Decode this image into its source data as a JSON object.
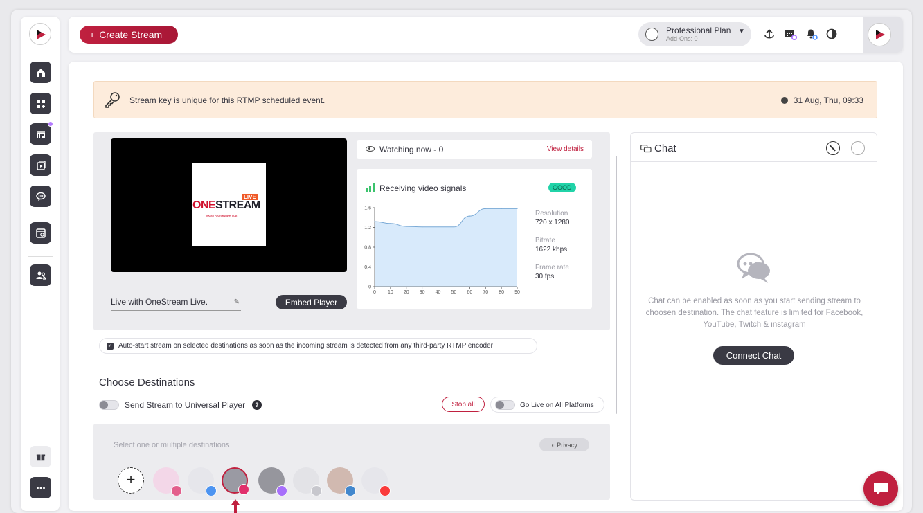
{
  "header": {
    "create_stream_label": "Create Stream",
    "plan_name": "Professional Plan",
    "addons": "Add-Ons: 0"
  },
  "banner": {
    "text": "Stream key is unique for this RTMP scheduled event.",
    "datetime": "31 Aug, Thu, 09:33"
  },
  "preview": {
    "card_live": "LIVE",
    "card_brand_one": "ONE",
    "card_brand_stream": "STREAM",
    "card_url": "www.onestream.live",
    "stream_title": "Live with OneStream Live.",
    "embed_label": "Embed Player"
  },
  "watching": {
    "text": "Watching now - 0",
    "view_details": "View details"
  },
  "signal": {
    "title": "Receiving video signals",
    "badge": "GOOD",
    "resolution_label": "Resolution",
    "resolution_value": "720 x 1280",
    "bitrate_label": "Bitrate",
    "bitrate_value": "1622 kbps",
    "framerate_label": "Frame rate",
    "framerate_value": "30 fps"
  },
  "chart_data": {
    "type": "area",
    "x": [
      0,
      10,
      20,
      30,
      40,
      50,
      60,
      70,
      80,
      90
    ],
    "values": [
      1.32,
      1.28,
      1.22,
      1.21,
      1.21,
      1.21,
      1.43,
      1.58,
      1.58,
      1.58
    ],
    "xticks": [
      "0",
      "10",
      "20",
      "30",
      "40",
      "50",
      "60",
      "70",
      "80",
      "90"
    ],
    "yticks": [
      "0",
      "0.4",
      "0.8",
      "1.2",
      "1.6"
    ],
    "ylim": [
      0,
      1.6
    ],
    "xlim": [
      0,
      90
    ],
    "color": "#d8eafb",
    "stroke": "#7aaad6"
  },
  "autostart": {
    "text": "Auto-start stream on selected destinations as soon as the incoming stream is detected from any third-party RTMP encoder"
  },
  "destinations": {
    "title": "Choose Destinations",
    "universal_label": "Send Stream to Universal Player",
    "help": "?",
    "stop_all": "Stop all",
    "go_live_all": "Go Live on All Platforms",
    "hint": "Select one or multiple destinations",
    "privacy": "Privacy",
    "items": [
      {
        "name": "instagram",
        "color": "#f6d1e6"
      },
      {
        "name": "facebook",
        "color": "#e5e5ea"
      },
      {
        "name": "instagram-selected",
        "color": "#9a9aa3"
      },
      {
        "name": "twitch",
        "color": "#7a7a82"
      },
      {
        "name": "rtmp",
        "color": "#e0e0e5"
      },
      {
        "name": "linkedin",
        "color": "#c9a99b"
      },
      {
        "name": "youtube",
        "color": "#e5e5ea"
      }
    ]
  },
  "chat": {
    "title": "Chat",
    "message": "Chat can be enabled as soon as you start sending stream to choosen destination. The chat feature is limited for Facebook, YouTube, Twitch & instagram",
    "connect_label": "Connect Chat"
  }
}
